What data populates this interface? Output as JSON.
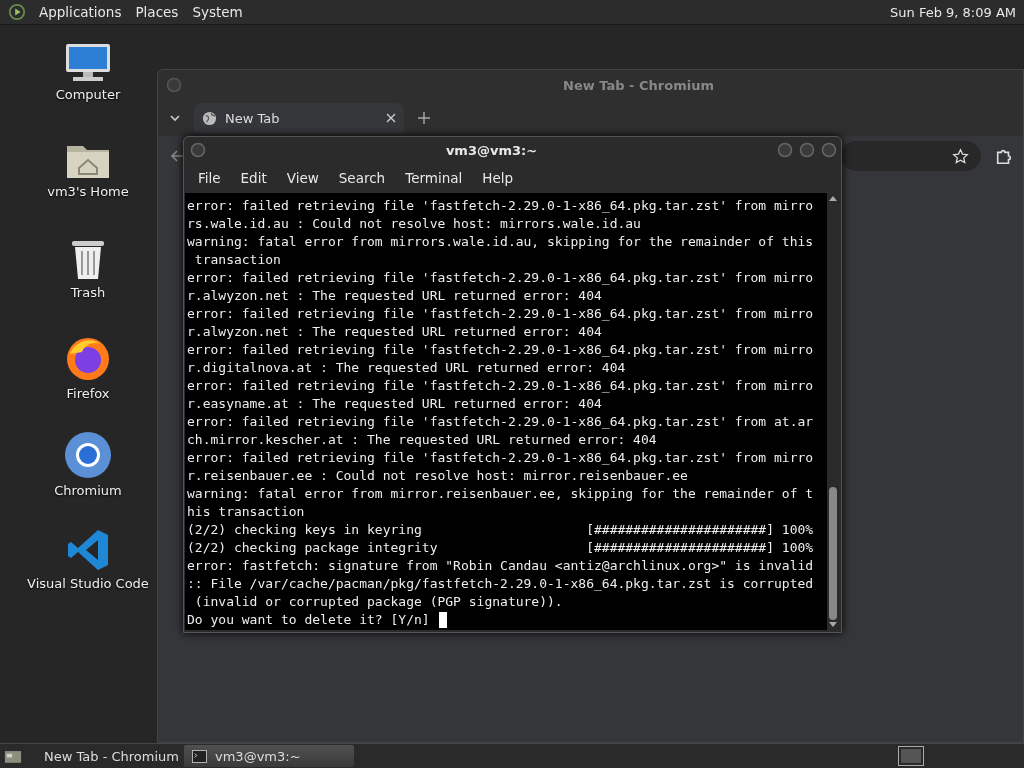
{
  "top_panel": {
    "menus": [
      "Applications",
      "Places",
      "System"
    ],
    "clock": "Sun Feb  9,  8:09 AM"
  },
  "desktop_icons": [
    {
      "label": "Computer",
      "kind": "computer"
    },
    {
      "label": "vm3's Home",
      "kind": "folder"
    },
    {
      "label": "Trash",
      "kind": "trash"
    },
    {
      "label": "Firefox",
      "kind": "firefox"
    },
    {
      "label": "Chromium",
      "kind": "chromium"
    },
    {
      "label": "Visual Studio Code",
      "kind": "vscode"
    }
  ],
  "browser_window": {
    "title": "New Tab - Chromium",
    "tabs": [
      {
        "label": "New Tab",
        "selected": true
      }
    ]
  },
  "terminal_window": {
    "title": "vm3@vm3:~",
    "menus": [
      "File",
      "Edit",
      "View",
      "Search",
      "Terminal",
      "Help"
    ],
    "lines": [
      "error: failed retrieving file 'fastfetch-2.29.0-1-x86_64.pkg.tar.zst' from mirro",
      "rs.wale.id.au : Could not resolve host: mirrors.wale.id.au",
      "warning: fatal error from mirrors.wale.id.au, skipping for the remainder of this",
      " transaction",
      "error: failed retrieving file 'fastfetch-2.29.0-1-x86_64.pkg.tar.zst' from mirro",
      "r.alwyzon.net : The requested URL returned error: 404",
      "error: failed retrieving file 'fastfetch-2.29.0-1-x86_64.pkg.tar.zst' from mirro",
      "r.alwyzon.net : The requested URL returned error: 404",
      "error: failed retrieving file 'fastfetch-2.29.0-1-x86_64.pkg.tar.zst' from mirro",
      "r.digitalnova.at : The requested URL returned error: 404",
      "error: failed retrieving file 'fastfetch-2.29.0-1-x86_64.pkg.tar.zst' from mirro",
      "r.easyname.at : The requested URL returned error: 404",
      "error: failed retrieving file 'fastfetch-2.29.0-1-x86_64.pkg.tar.zst' from at.ar",
      "ch.mirror.kescher.at : The requested URL returned error: 404",
      "error: failed retrieving file 'fastfetch-2.29.0-1-x86_64.pkg.tar.zst' from mirro",
      "r.reisenbauer.ee : Could not resolve host: mirror.reisenbauer.ee",
      "warning: fatal error from mirror.reisenbauer.ee, skipping for the remainder of t",
      "his transaction",
      "(2/2) checking keys in keyring                     [######################] 100%",
      "(2/2) checking package integrity                   [######################] 100%",
      "error: fastfetch: signature from \"Robin Candau <antiz@archlinux.org>\" is invalid",
      ":: File /var/cache/pacman/pkg/fastfetch-2.29.0-1-x86_64.pkg.tar.zst is corrupted",
      " (invalid or corrupted package (PGP signature)).",
      "Do you want to delete it? [Y/n] "
    ]
  },
  "taskbar": {
    "items": [
      {
        "label": "New Tab - Chromium",
        "kind": "chromium",
        "selected": false
      },
      {
        "label": "vm3@vm3:~",
        "kind": "terminal",
        "selected": true
      }
    ]
  }
}
